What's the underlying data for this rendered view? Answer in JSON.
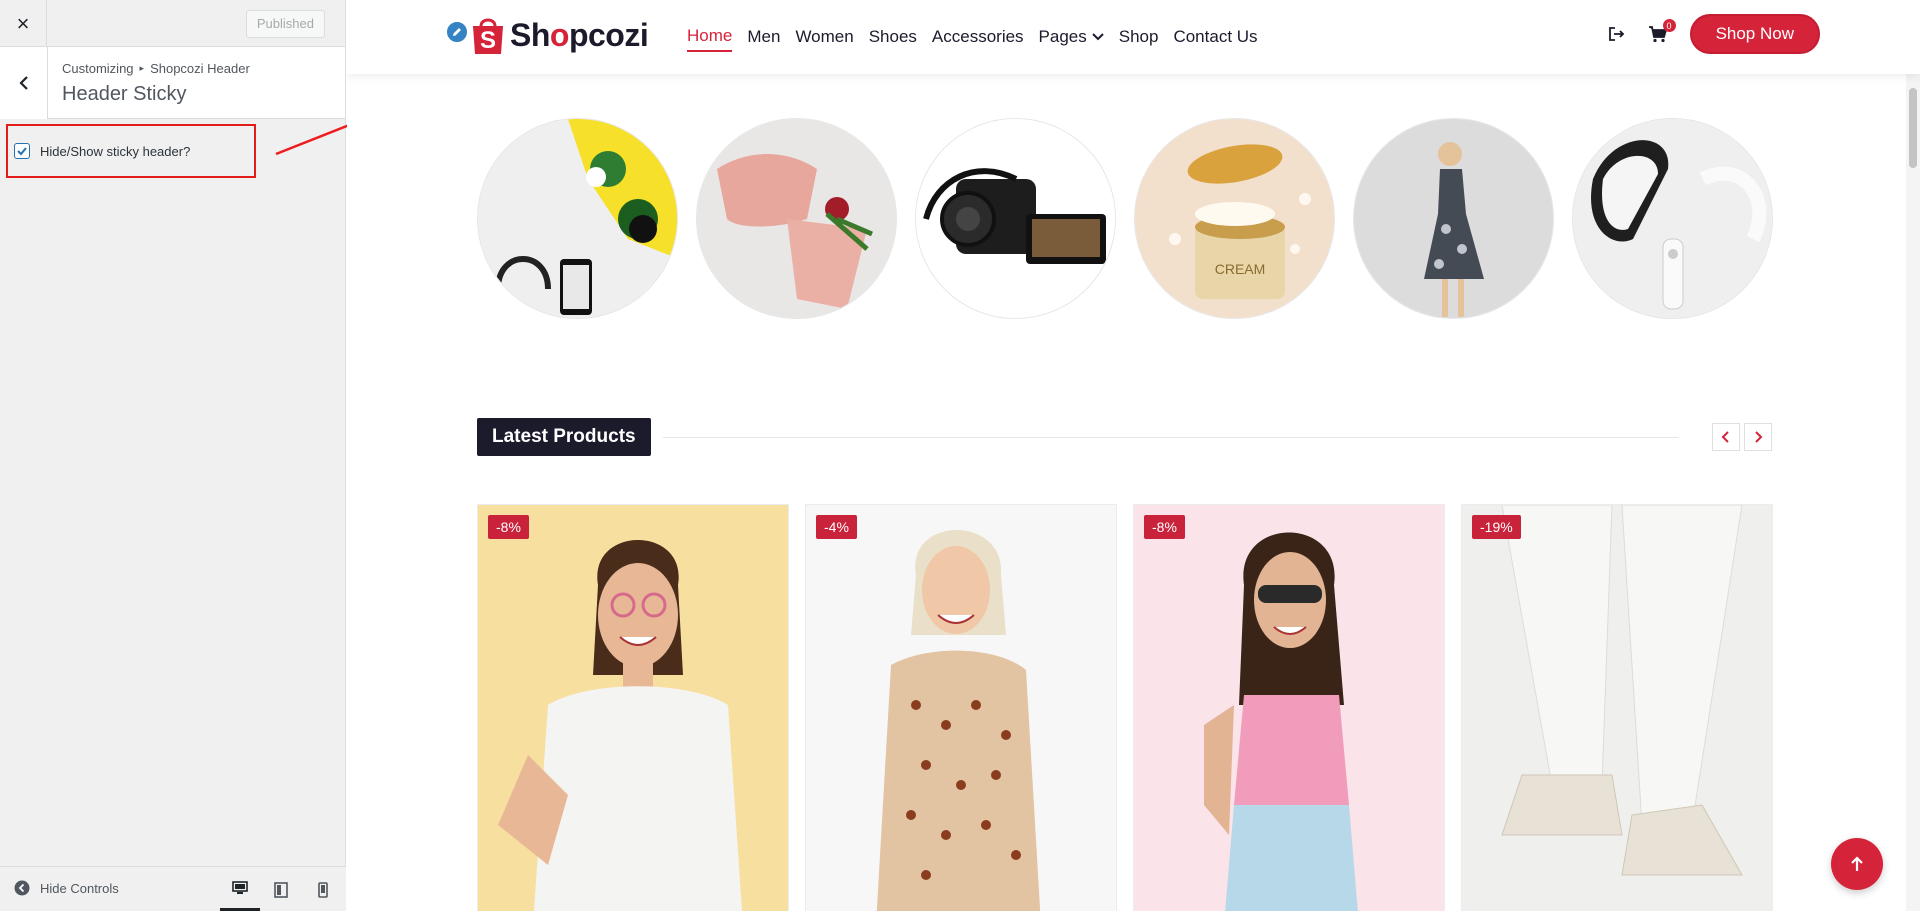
{
  "customizer": {
    "close_label": "×",
    "publish_label": "Published",
    "breadcrumb": [
      "Customizing",
      "Shopcozi Header"
    ],
    "breadcrumb_separator": "▸",
    "section_title": "Header Sticky",
    "control": {
      "label": "Hide/Show sticky header?",
      "checked": true
    },
    "footer": {
      "hide_controls_label": "Hide Controls",
      "devices": [
        "desktop-icon",
        "tablet-icon",
        "mobile-icon"
      ],
      "active_device": "desktop"
    }
  },
  "site": {
    "brand": {
      "prefix": "Sh",
      "accent": "o",
      "suffix": "pcozi",
      "color": "#1b1b2c",
      "accent_color": "#d5243a"
    },
    "nav": [
      {
        "label": "Home",
        "active": true
      },
      {
        "label": "Men"
      },
      {
        "label": "Women"
      },
      {
        "label": "Shoes"
      },
      {
        "label": "Accessories"
      },
      {
        "label": "Pages",
        "dropdown": true
      },
      {
        "label": "Shop"
      },
      {
        "label": "Contact Us"
      }
    ],
    "cart_count": "0",
    "cta_label": "Shop Now",
    "categories": [
      "accessories-flatlay",
      "lingerie",
      "camcorder",
      "cream-jar",
      "floral-dress",
      "vr-headset"
    ],
    "latest_products": {
      "heading": "Latest Products",
      "items": [
        {
          "badge": "-8%"
        },
        {
          "badge": "-4%"
        },
        {
          "badge": "-8%"
        },
        {
          "badge": "-19%"
        }
      ]
    }
  },
  "colors": {
    "accent": "#d5243a",
    "dark": "#1b1b2c",
    "wp_blue": "#2271b1"
  }
}
